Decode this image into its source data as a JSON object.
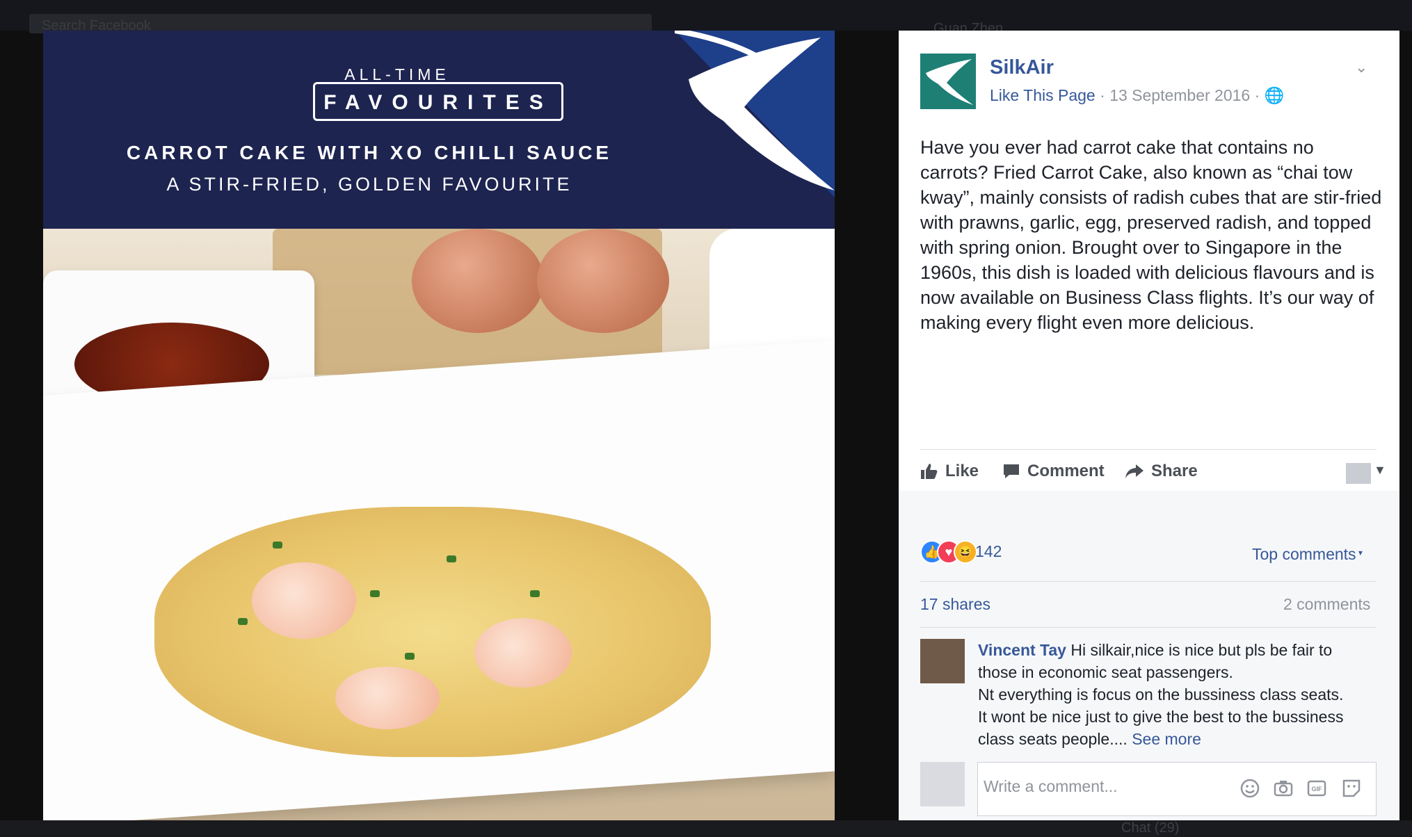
{
  "topbar": {
    "search_placeholder": "Search Facebook",
    "user_name": "Guan Zhen"
  },
  "image": {
    "kicker": "ALL-TIME",
    "badge": "FAVOURITES",
    "headline": "CARROT CAKE WITH XO CHILLI SAUCE",
    "subheadline": "A STIR-FRIED, GOLDEN FAVOURITE"
  },
  "post": {
    "page_name": "SilkAir",
    "like_page": "Like This Page",
    "date": "13 September 2016",
    "text": "Have you ever had carrot cake that contains no carrots? Fried Carrot Cake, also known as “chai tow kway”, mainly consists of radish cubes that are stir-fried with prawns, garlic, egg, preserved radish, and topped with spring onion. Brought over to Singapore in the 1960s, this dish is loaded with delicious flavours and is now available on Business Class flights. It’s our way of making every flight even more delicious."
  },
  "actions": {
    "like": "Like",
    "comment": "Comment",
    "share": "Share"
  },
  "stats": {
    "reaction_count": "142",
    "top_comments": "Top comments",
    "shares": "17 shares",
    "comments": "2 comments"
  },
  "comment": {
    "author": "Vincent Tay",
    "line1": "Hi silkair,nice is nice but pls be fair to those in economic seat passengers.",
    "line2": "Nt everything is focus on the bussiness class seats.",
    "line3": "It wont be nice just to give the best to the bussiness class seats people....",
    "see_more": "See more"
  },
  "composer": {
    "placeholder": "Write a comment..."
  },
  "footer": {
    "chat": "Chat (29)"
  },
  "colors": {
    "link": "#365899",
    "banner": "#1d2450",
    "brand_teal": "#1e7f75"
  }
}
